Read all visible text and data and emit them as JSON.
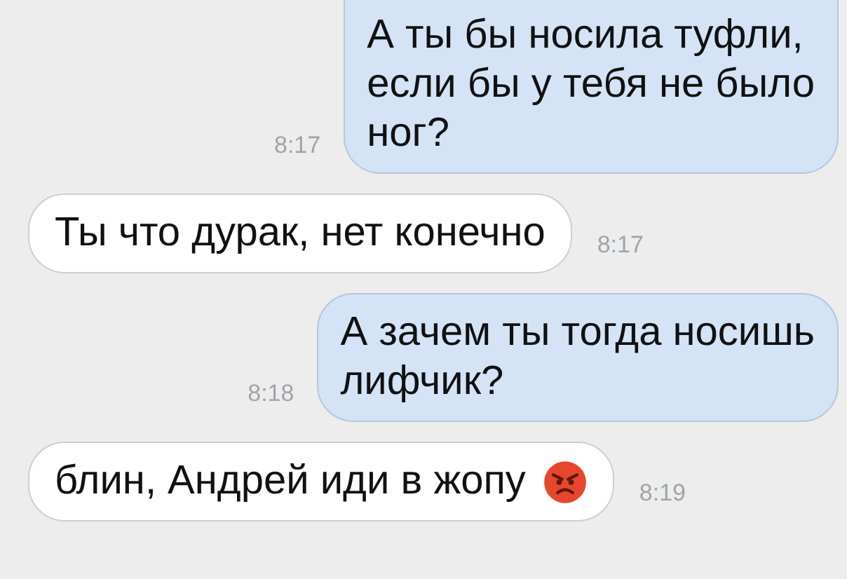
{
  "messages": [
    {
      "kind": "sent",
      "lines": [
        "А ты бы носила туфли,",
        "если бы у тебя не было",
        "ног?"
      ],
      "time": "8:17",
      "emoji": false
    },
    {
      "kind": "received",
      "lines": [
        "Ты что дурак, нет конечно"
      ],
      "time": "8:17",
      "emoji": false
    },
    {
      "kind": "sent",
      "lines": [
        "А зачем ты тогда носишь",
        "лифчик?"
      ],
      "time": "8:18",
      "emoji": false
    },
    {
      "kind": "received",
      "lines": [
        "блин, Андрей иди в жопу"
      ],
      "time": "8:19",
      "emoji": true
    }
  ]
}
